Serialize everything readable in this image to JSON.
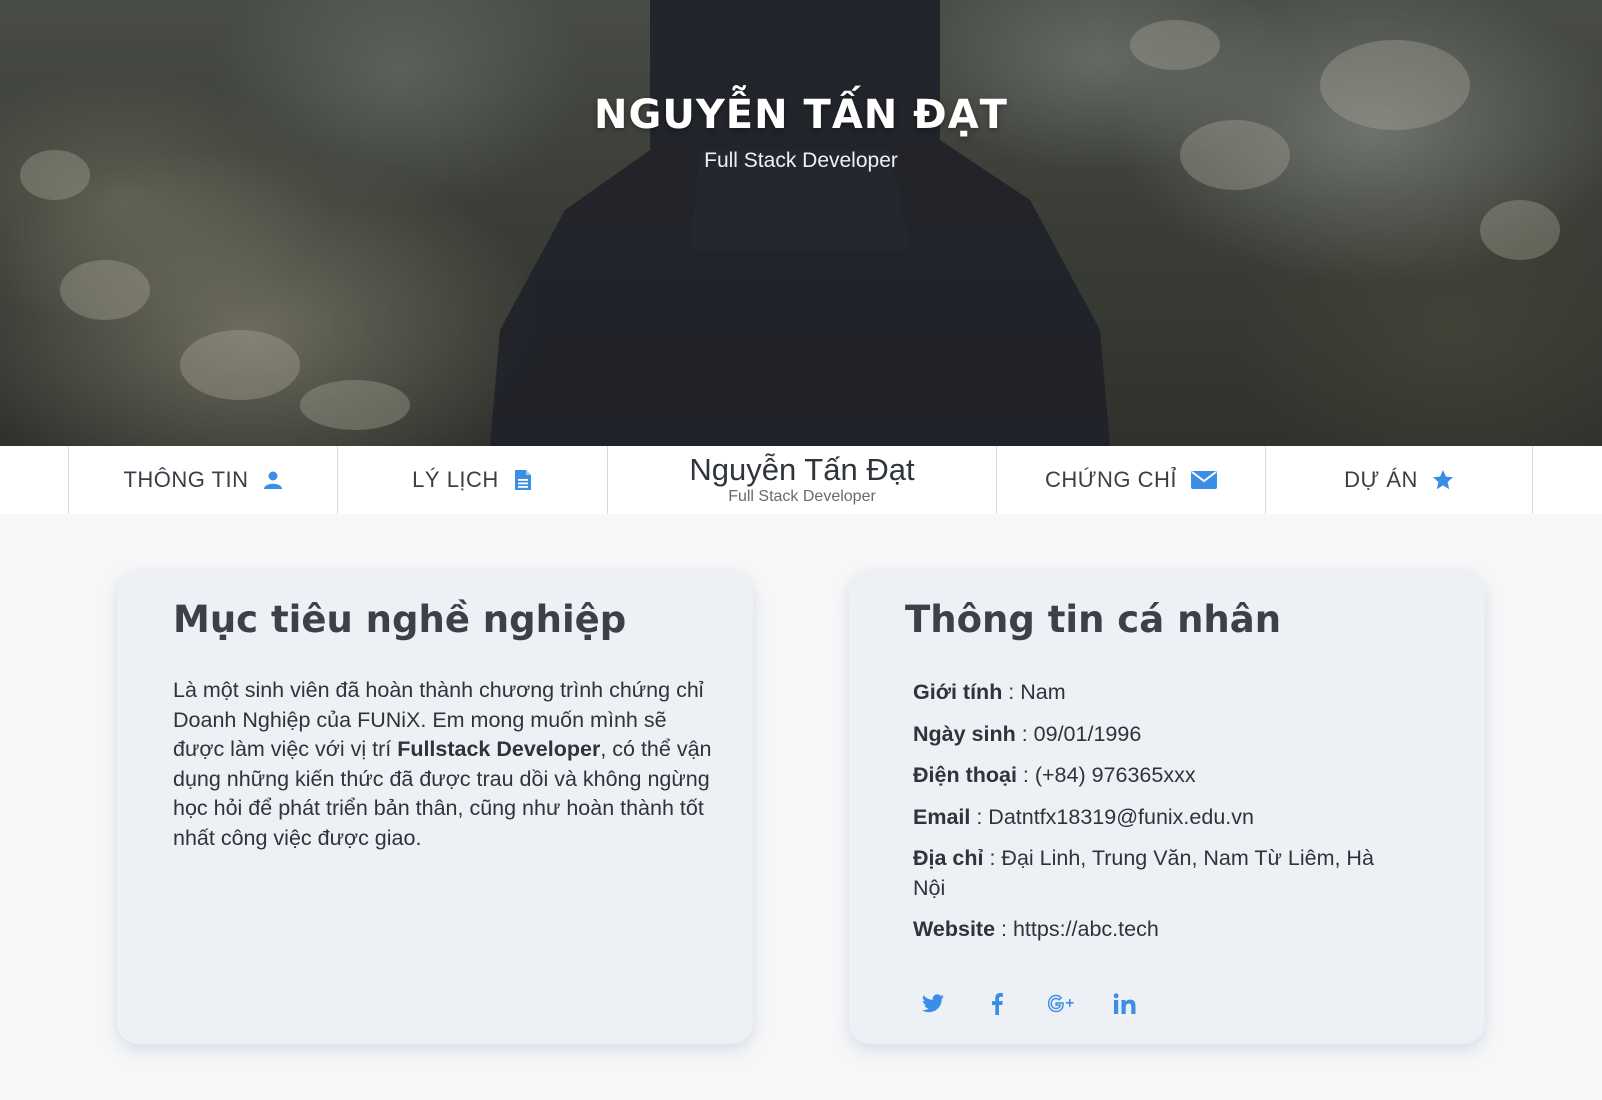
{
  "hero": {
    "name": "NGUYỄN TẤN ĐẠT",
    "role": "Full Stack Developer"
  },
  "nav": {
    "items": [
      {
        "label": "THÔNG TIN",
        "icon": "user-icon"
      },
      {
        "label": "LÝ LỊCH",
        "icon": "document-icon"
      },
      {
        "label": "CHỨNG CHỈ",
        "icon": "envelope-icon"
      },
      {
        "label": "DỰ ÁN",
        "icon": "star-icon"
      }
    ],
    "brand_name": "Nguyễn Tấn Đạt",
    "brand_role": "Full Stack Developer"
  },
  "objective": {
    "title": "Mục tiêu nghề nghiệp",
    "text_before": "Là một sinh viên đã hoàn thành chương trình chứng chỉ Doanh Nghiệp của FUNiX. Em mong muốn mình sẽ được làm việc với vị trí ",
    "text_bold": "Fullstack Developer",
    "text_after": ", có thể vận dụng những kiến thức đã được trau dồi và không ngừng học hỏi để phát triển bản thân, cũng như hoàn thành tốt nhất công việc được giao."
  },
  "personal": {
    "title": "Thông tin cá nhân",
    "fields": [
      {
        "label": "Giới tính",
        "value": " : Nam"
      },
      {
        "label": "Ngày sinh",
        "value": " : 09/01/1996"
      },
      {
        "label": "Điện thoại",
        "value": " : (+84) 976365xxx"
      },
      {
        "label": "Email",
        "value": " : Datntfx18319@funix.edu.vn"
      },
      {
        "label": "Địa chỉ",
        "value": " : Đại Linh, Trung Văn, Nam Từ Liêm, Hà Nội"
      },
      {
        "label": "Website",
        "value": " : https://abc.tech"
      }
    ],
    "socials": [
      "twitter-icon",
      "facebook-icon",
      "google-plus-icon",
      "linkedin-icon"
    ]
  },
  "colors": {
    "accent": "#3a8ee6",
    "card_bg": "#edf1f5",
    "page_bg": "#f7f7f8"
  }
}
